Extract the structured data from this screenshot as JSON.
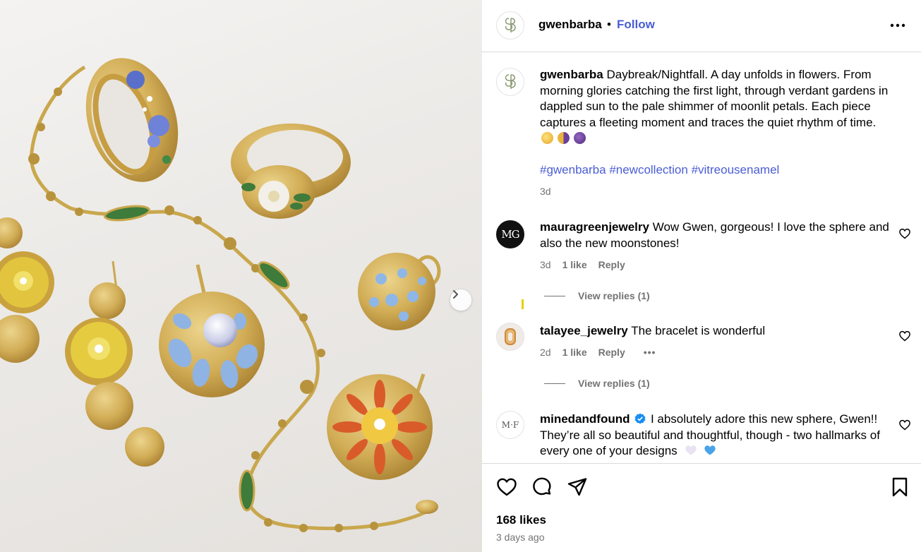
{
  "post": {
    "author": "gwenbarba",
    "follow_label": "Follow",
    "separator": "•",
    "caption_text": "Daybreak/Nightfall. A day unfolds in flowers. From morning glories catching the first light, through verdant gardens in dappled sun to the pale shimmer of moonlit petals. Each piece captures a fleeting moment and traces the quiet rhythm of time.",
    "caption_emojis": [
      "sun-emoji",
      "half-moon-emoji",
      "purple-moon-emoji"
    ],
    "hashtags": [
      "#gwenbarba",
      "#newcollection",
      "#vitreousenamel"
    ],
    "caption_time": "3d",
    "likes": "168 likes",
    "posted": "3 days ago"
  },
  "comments": [
    {
      "username": "mauragreenjewelry",
      "avatar_text": "MG",
      "text": "Wow Gwen, gorgeous! I love the sphere and also the new moonstones!",
      "time": "3d",
      "likes": "1 like",
      "reply": "Reply",
      "view_replies": "View replies (1)"
    },
    {
      "username": "talayee_jewelry",
      "text": "The bracelet is wonderful",
      "time": "2d",
      "likes": "1 like",
      "reply": "Reply",
      "more": "•••",
      "view_replies": "View replies (1)"
    },
    {
      "username": "minedandfound",
      "avatar_text": "M·F",
      "verified": true,
      "text": "I absolutely adore this new sphere, Gwen!! They’re all so beautiful and thoughtful, though - two hallmarks of every one of your designs",
      "emojis": [
        "white-heart-emoji",
        "blue-heart-emoji"
      ]
    }
  ],
  "colors": {
    "link_blue": "#4a5dd6",
    "muted_text": "#737373",
    "divider": "#dbdbdb",
    "gold": "#d4b25a"
  }
}
